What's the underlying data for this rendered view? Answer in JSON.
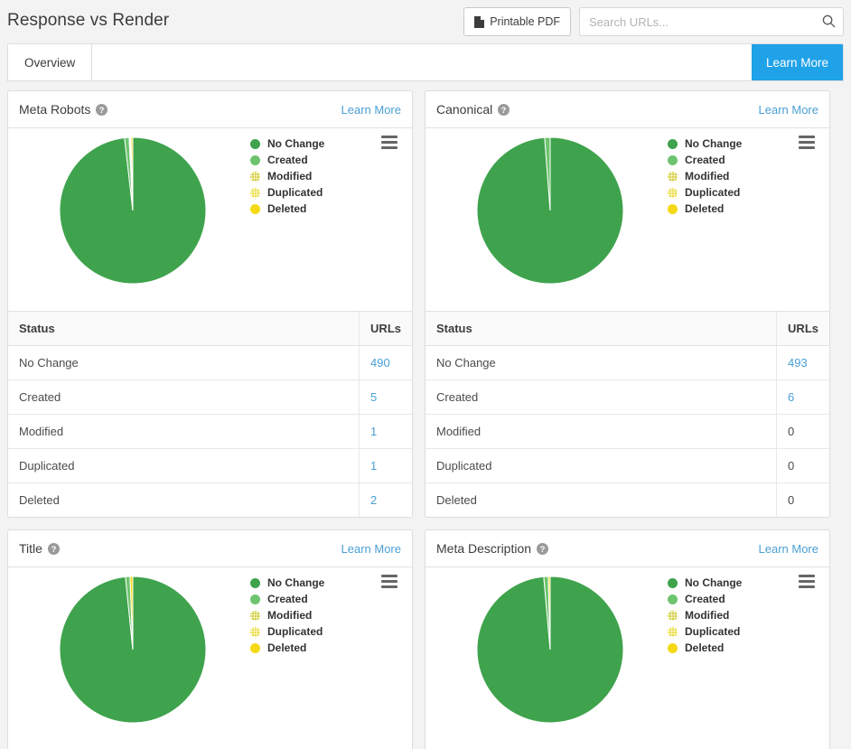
{
  "header": {
    "title": "Response vs Render",
    "printable_pdf_label": "Printable PDF",
    "printable_pdf_icon": "document-icon",
    "search_placeholder": "Search URLs...",
    "search_value": "",
    "search_icon": "search-icon"
  },
  "tabs": {
    "items": [
      {
        "label": "Overview",
        "active": true
      }
    ],
    "learn_more_label": "Learn More"
  },
  "colors": {
    "accent_blue": "#1fa2e8",
    "link_blue": "#4a9fd4",
    "no_change": "#4aa council",
    "series": [
      "#3fa34d",
      "#6ec46e",
      "#d8d449",
      "#ecdf4e",
      "#f5d916"
    ]
  },
  "legend": {
    "items": [
      {
        "label": "No Change",
        "color": "#3fa34d",
        "pattern": "solid"
      },
      {
        "label": "Created",
        "color": "#6ec46e",
        "pattern": "solid"
      },
      {
        "label": "Modified",
        "color": "#d6d24a",
        "pattern": "dotted"
      },
      {
        "label": "Duplicated",
        "color": "#ecdf4e",
        "pattern": "dotted"
      },
      {
        "label": "Deleted",
        "color": "#f5d916",
        "pattern": "solid"
      }
    ],
    "menu_icon": "hamburger-menu-icon"
  },
  "table_headers": {
    "status": "Status",
    "urls": "URLs"
  },
  "help_icon": "question-mark-icon",
  "learn_more_label": "Learn More",
  "panels": [
    {
      "title": "Meta Robots",
      "learn_more": "Learn More",
      "rows": [
        {
          "status": "No Change",
          "urls": "490",
          "is_link": true
        },
        {
          "status": "Created",
          "urls": "5",
          "is_link": true
        },
        {
          "status": "Modified",
          "urls": "1",
          "is_link": true
        },
        {
          "status": "Duplicated",
          "urls": "1",
          "is_link": true
        },
        {
          "status": "Deleted",
          "urls": "2",
          "is_link": true
        }
      ]
    },
    {
      "title": "Canonical",
      "learn_more": "Learn More",
      "rows": [
        {
          "status": "No Change",
          "urls": "493",
          "is_link": true
        },
        {
          "status": "Created",
          "urls": "6",
          "is_link": true
        },
        {
          "status": "Modified",
          "urls": "0",
          "is_link": false
        },
        {
          "status": "Duplicated",
          "urls": "0",
          "is_link": false
        },
        {
          "status": "Deleted",
          "urls": "0",
          "is_link": false
        }
      ]
    },
    {
      "title": "Title",
      "learn_more": "Learn More",
      "rows": []
    },
    {
      "title": "Meta Description",
      "learn_more": "Learn More",
      "rows": []
    }
  ],
  "chart_data": [
    {
      "type": "pie",
      "title": "Meta Robots",
      "labels": [
        "No Change",
        "Created",
        "Modified",
        "Duplicated",
        "Deleted"
      ],
      "values": [
        490,
        5,
        1,
        1,
        2
      ],
      "colors": [
        "#3fa34d",
        "#6ec46e",
        "#d6d24a",
        "#ecdf4e",
        "#f5d916"
      ],
      "legend_position": "right"
    },
    {
      "type": "pie",
      "title": "Canonical",
      "labels": [
        "No Change",
        "Created",
        "Modified",
        "Duplicated",
        "Deleted"
      ],
      "values": [
        493,
        6,
        0,
        0,
        0
      ],
      "colors": [
        "#3fa34d",
        "#6ec46e",
        "#d6d24a",
        "#ecdf4e",
        "#f5d916"
      ],
      "legend_position": "right"
    },
    {
      "type": "pie",
      "title": "Title",
      "labels": [
        "No Change",
        "Created",
        "Modified",
        "Duplicated",
        "Deleted"
      ],
      "values": [
        491,
        5,
        0,
        0,
        3
      ],
      "colors": [
        "#3fa34d",
        "#6ec46e",
        "#d6d24a",
        "#ecdf4e",
        "#f5d916"
      ],
      "legend_position": "right"
    },
    {
      "type": "pie",
      "title": "Meta Description",
      "labels": [
        "No Change",
        "Created",
        "Modified",
        "Duplicated",
        "Deleted"
      ],
      "values": [
        492,
        5,
        0,
        0,
        2
      ],
      "colors": [
        "#3fa34d",
        "#6ec46e",
        "#d6d24a",
        "#ecdf4e",
        "#f5d916"
      ],
      "legend_position": "right"
    }
  ]
}
